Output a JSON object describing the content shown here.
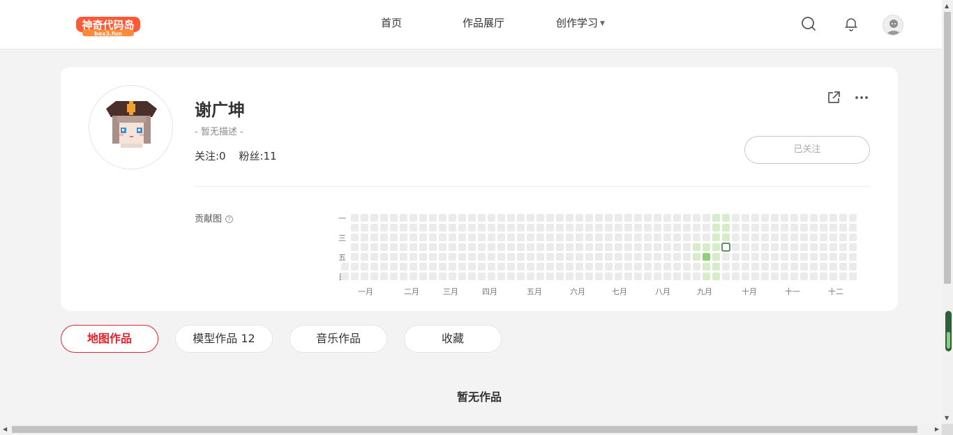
{
  "header": {
    "logo_text": "神奇代码岛",
    "logo_sub": "box3.fun",
    "nav": [
      {
        "label": "首页"
      },
      {
        "label": "作品展厅"
      },
      {
        "label": "创作学习",
        "has_dropdown": true
      }
    ],
    "icons": [
      "search-icon",
      "bell-icon",
      "user-avatar"
    ]
  },
  "profile": {
    "name": "谢广坤",
    "description": "- 暂无描述 -",
    "following_label": "关注:0",
    "followers_label": "粉丝:11",
    "follow_button": "已关注",
    "actions": [
      "share-icon",
      "more-icon"
    ]
  },
  "contribution": {
    "label": "贡献图",
    "weekday_labels": [
      "一",
      "",
      "三",
      "",
      "五",
      "",
      "日"
    ],
    "month_labels": [
      "一月",
      "二月",
      "三月",
      "四月",
      "五月",
      "六月",
      "七月",
      "八月",
      "九月",
      "十月",
      "十一",
      "十二"
    ],
    "weeks": 53,
    "active_cells": [
      {
        "week": 36,
        "day": 3,
        "level": 1
      },
      {
        "week": 36,
        "day": 4,
        "level": 1
      },
      {
        "week": 37,
        "day": 3,
        "level": 1
      },
      {
        "week": 37,
        "day": 4,
        "level": 3
      },
      {
        "week": 37,
        "day": 5,
        "level": 1
      },
      {
        "week": 37,
        "day": 6,
        "level": 1
      },
      {
        "week": 38,
        "day": 0,
        "level": 1
      },
      {
        "week": 38,
        "day": 1,
        "level": 1
      },
      {
        "week": 38,
        "day": 2,
        "level": 1
      },
      {
        "week": 38,
        "day": 3,
        "level": 1
      },
      {
        "week": 38,
        "day": 4,
        "level": 1
      },
      {
        "week": 38,
        "day": 5,
        "level": 1
      },
      {
        "week": 38,
        "day": 6,
        "level": 1
      },
      {
        "week": 39,
        "day": 0,
        "level": 1
      },
      {
        "week": 39,
        "day": 1,
        "level": 1
      },
      {
        "week": 39,
        "day": 2,
        "level": 1
      }
    ],
    "today_cell": {
      "week": 39,
      "day": 3
    },
    "colors": {
      "empty": "#ebebeb",
      "level1": "#d6edc8",
      "level3": "#8fd07a",
      "today_border": "#2e6b34"
    }
  },
  "tabs": [
    {
      "label": "地图作品",
      "active": true
    },
    {
      "label": "模型作品 12",
      "active": false
    },
    {
      "label": "音乐作品",
      "active": false
    },
    {
      "label": "收藏",
      "active": false
    }
  ],
  "empty_state": "暂无作品",
  "accent_color": "#e3242b"
}
